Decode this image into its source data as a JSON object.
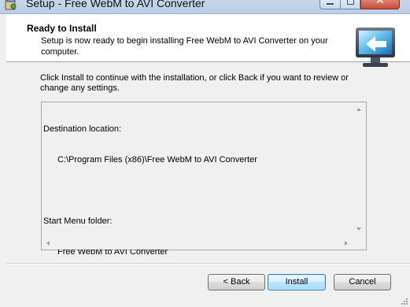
{
  "window": {
    "title": "Setup - Free WebM to AVI Converter",
    "close_glyph": "✕"
  },
  "header": {
    "title": "Ready to Install",
    "description": "Setup is now ready to begin installing Free WebM to AVI Converter on your computer.",
    "image_icon": "monitor-install-icon"
  },
  "body": {
    "intro": "Click Install to continue with the installation, or click Back if you want to review or change any settings.",
    "memo": {
      "destination_label": "Destination location:",
      "destination_value": "C:\\Program Files (x86)\\Free WebM to AVI Converter",
      "start_menu_label": "Start Menu folder:",
      "start_menu_value": "Free WebM to AVI Converter"
    }
  },
  "buttons": {
    "back": "< Back",
    "install": "Install",
    "cancel": "Cancel"
  },
  "colors": {
    "accent": "#3c7fb1",
    "close": "#c74b36"
  }
}
